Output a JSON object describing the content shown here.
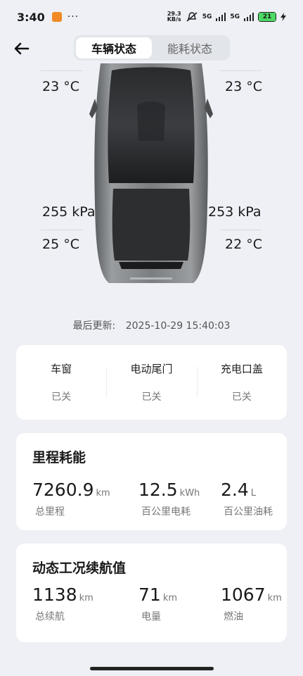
{
  "status_bar": {
    "time": "3:40",
    "network_speed_top": "29.3",
    "network_speed_unit": "KB/s",
    "signal1": "5G",
    "signal2": "5G",
    "battery": "21",
    "dots": "···"
  },
  "header": {
    "tabs": [
      {
        "label": "车辆状态",
        "active": true
      },
      {
        "label": "能耗状态",
        "active": false
      }
    ]
  },
  "car": {
    "front_left_temp": "23 °C",
    "front_right_temp": "23 °C",
    "rear_left_pressure": "255 kPa",
    "rear_right_pressure": "253 kPa",
    "rear_left_temp": "25 °C",
    "rear_right_temp": "22 °C"
  },
  "updated": {
    "label": "最后更新:",
    "value": "2025-10-29 15:40:03"
  },
  "status": [
    {
      "label": "车窗",
      "value": "已关"
    },
    {
      "label": "电动尾门",
      "value": "已关"
    },
    {
      "label": "充电口盖",
      "value": "已关"
    }
  ],
  "mileage": {
    "title": "里程耗能",
    "items": [
      {
        "value": "7260.9",
        "unit": "km",
        "desc": "总里程"
      },
      {
        "value": "12.5",
        "unit": "kWh",
        "desc": "百公里电耗"
      },
      {
        "value": "2.4",
        "unit": "L",
        "desc": "百公里油耗"
      }
    ]
  },
  "range": {
    "title": "动态工况续航值",
    "items": [
      {
        "value": "1138",
        "unit": "km",
        "desc": "总续航"
      },
      {
        "value": "71",
        "unit": "km",
        "desc": "电量"
      },
      {
        "value": "1067",
        "unit": "km",
        "desc": "燃油"
      }
    ]
  }
}
